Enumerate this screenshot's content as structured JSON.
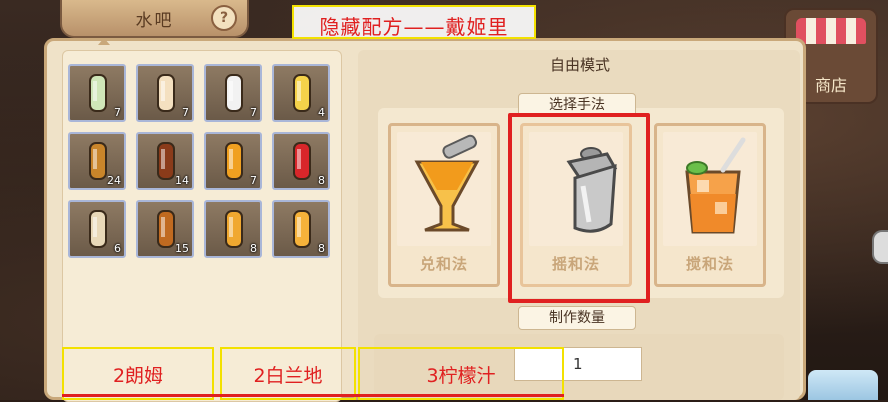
{
  "header": {
    "tab_title": "水吧",
    "help_icon": "?",
    "shop_label": "商店"
  },
  "annotations": {
    "top": "隐藏配方——戴姬里",
    "bottom": [
      "2朗姆",
      "2白兰地",
      "3柠檬汁"
    ],
    "color": "#e02020",
    "box_color": "#f3e100"
  },
  "inventory": [
    {
      "icon": "bottle-icon",
      "count": "7"
    },
    {
      "icon": "ice-cream-icon",
      "count": "7"
    },
    {
      "icon": "sugar-icon",
      "count": "7"
    },
    {
      "icon": "lemon-juice-icon",
      "count": "4"
    },
    {
      "icon": "rum-icon",
      "count": "24"
    },
    {
      "icon": "brandy-icon",
      "count": "14"
    },
    {
      "icon": "honey-icon",
      "count": "7"
    },
    {
      "icon": "cola-can-icon",
      "count": "8"
    },
    {
      "icon": "martini-icon",
      "count": "6"
    },
    {
      "icon": "whiskey-icon",
      "count": "15"
    },
    {
      "icon": "orange-juice-icon",
      "count": "8"
    },
    {
      "icon": "tropical-drink-icon",
      "count": "8"
    }
  ],
  "main": {
    "mode_title": "自由模式",
    "method_heading": "选择手法",
    "methods": [
      {
        "label": "兑和法",
        "icon": "mixing-glass-icon"
      },
      {
        "label": "摇和法",
        "icon": "shaker-icon",
        "selected": true
      },
      {
        "label": "搅和法",
        "icon": "stirred-glass-icon"
      }
    ],
    "quantity_heading": "制作数量",
    "quantity_value": "1"
  }
}
